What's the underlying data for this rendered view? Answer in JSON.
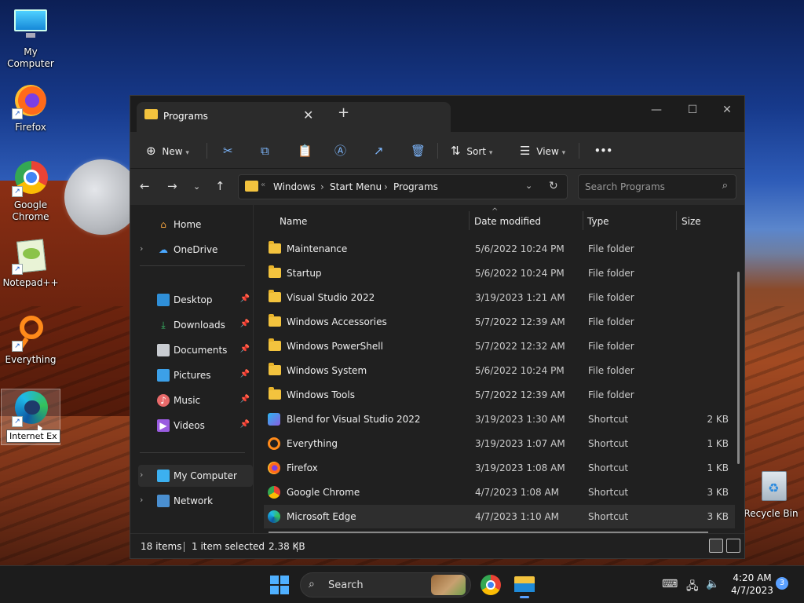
{
  "desktop": {
    "icons": [
      {
        "label": "My Computer",
        "icon": "computer-icon"
      },
      {
        "label": "Firefox",
        "icon": "firefox-icon"
      },
      {
        "label": "Google Chrome",
        "icon": "chrome-icon"
      },
      {
        "label": "Notepad++",
        "icon": "notepadpp-icon"
      },
      {
        "label": "Everything",
        "icon": "everything-icon"
      },
      {
        "label": "Internet Ex",
        "icon": "edge-icon"
      }
    ],
    "tooltip": "Internet Ex",
    "recycle_bin": "Recycle Bin"
  },
  "window": {
    "tab_title": "Programs",
    "toolbar": {
      "new_label": "New",
      "sort_label": "Sort",
      "view_label": "View",
      "more_label": "•••"
    },
    "address": {
      "crumbs": [
        "Windows",
        "Start Menu",
        "Programs"
      ],
      "search_placeholder": "Search Programs"
    },
    "nav_pane": [
      {
        "label": "Home",
        "icon": "home-icon"
      },
      {
        "label": "OneDrive",
        "icon": "onedrive-icon"
      },
      {
        "label": "Desktop",
        "icon": "desktop-icon",
        "pinned": true
      },
      {
        "label": "Downloads",
        "icon": "downloads-icon",
        "pinned": true
      },
      {
        "label": "Documents",
        "icon": "documents-icon",
        "pinned": true
      },
      {
        "label": "Pictures",
        "icon": "pictures-icon",
        "pinned": true
      },
      {
        "label": "Music",
        "icon": "music-icon",
        "pinned": true
      },
      {
        "label": "Videos",
        "icon": "videos-icon",
        "pinned": true
      },
      {
        "label": "My Computer",
        "icon": "computer-icon"
      },
      {
        "label": "Network",
        "icon": "network-icon"
      }
    ],
    "columns": [
      "Name",
      "Date modified",
      "Type",
      "Size"
    ],
    "files": [
      {
        "name": "Maintenance",
        "date": "5/6/2022 10:24 PM",
        "type": "File folder",
        "size": ""
      },
      {
        "name": "Startup",
        "date": "5/6/2022 10:24 PM",
        "type": "File folder",
        "size": ""
      },
      {
        "name": "Visual Studio 2022",
        "date": "3/19/2023 1:21 AM",
        "type": "File folder",
        "size": ""
      },
      {
        "name": "Windows Accessories",
        "date": "5/7/2022 12:39 AM",
        "type": "File folder",
        "size": ""
      },
      {
        "name": "Windows PowerShell",
        "date": "5/7/2022 12:32 AM",
        "type": "File folder",
        "size": ""
      },
      {
        "name": "Windows System",
        "date": "5/6/2022 10:24 PM",
        "type": "File folder",
        "size": ""
      },
      {
        "name": "Windows Tools",
        "date": "5/7/2022 12:39 AM",
        "type": "File folder",
        "size": ""
      },
      {
        "name": "Blend for Visual Studio 2022",
        "date": "3/19/2023 1:30 AM",
        "type": "Shortcut",
        "size": "2 KB"
      },
      {
        "name": "Everything",
        "date": "3/19/2023 1:07 AM",
        "type": "Shortcut",
        "size": "1 KB"
      },
      {
        "name": "Firefox",
        "date": "3/19/2023 1:08 AM",
        "type": "Shortcut",
        "size": "1 KB"
      },
      {
        "name": "Google Chrome",
        "date": "4/7/2023 1:08 AM",
        "type": "Shortcut",
        "size": "3 KB"
      },
      {
        "name": "Microsoft Edge",
        "date": "4/7/2023 1:10 AM",
        "type": "Shortcut",
        "size": "3 KB"
      }
    ],
    "status": {
      "items": "18 items",
      "selected": "1 item selected",
      "size": "2.38 KB"
    }
  },
  "taskbar": {
    "search_label": "Search",
    "time": "4:20 AM",
    "date": "4/7/2023",
    "notifications": "3"
  },
  "colors": {
    "accent": "#4fb0ff",
    "folder": "#f3c33e",
    "window_bg": "#202020"
  }
}
